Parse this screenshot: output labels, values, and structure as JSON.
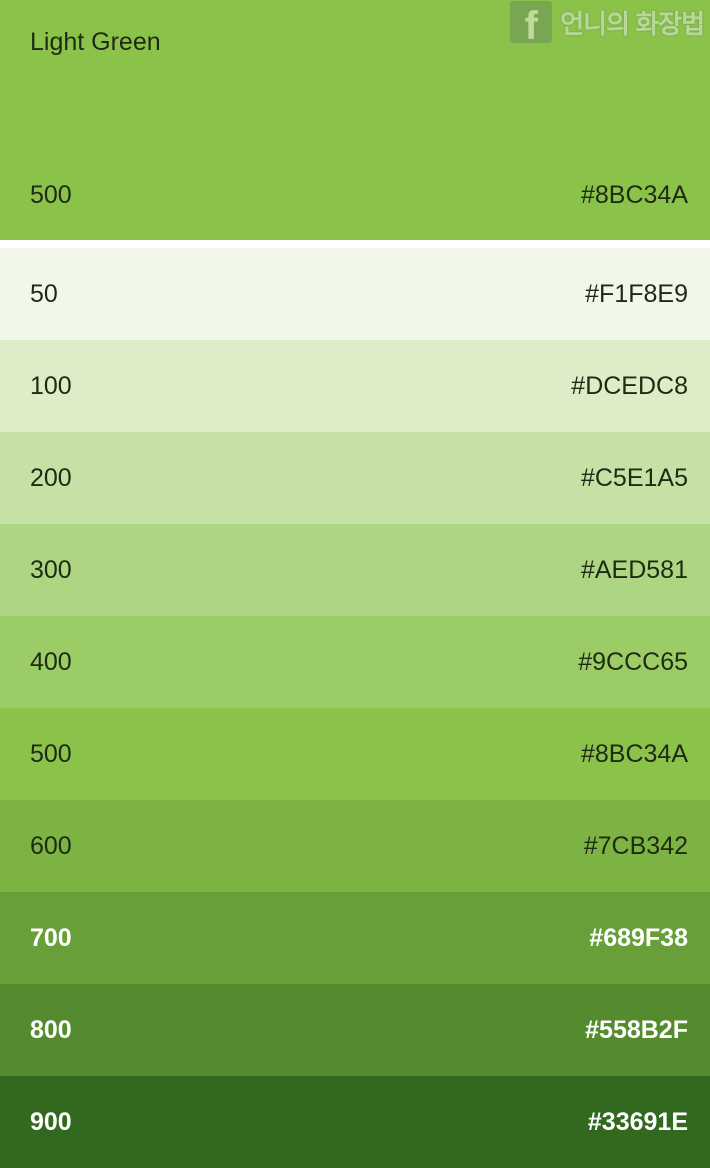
{
  "header": {
    "name": "Light Green",
    "shade": "500",
    "hex": "#8BC34A",
    "color": "#8BC34A"
  },
  "watermark": {
    "icon": "facebook-icon",
    "icon_glyph": "f",
    "text": "언니의 화장법"
  },
  "swatches": [
    {
      "shade": "50",
      "hex": "#F1F8E9",
      "color": "#F1F8E9",
      "text": "dark"
    },
    {
      "shade": "100",
      "hex": "#DCEDC8",
      "color": "#DCEDC8",
      "text": "dark"
    },
    {
      "shade": "200",
      "hex": "#C5E1A5",
      "color": "#C5E1A5",
      "text": "dark"
    },
    {
      "shade": "300",
      "hex": "#AED581",
      "color": "#AED581",
      "text": "dark"
    },
    {
      "shade": "400",
      "hex": "#9CCC65",
      "color": "#9CCC65",
      "text": "dark"
    },
    {
      "shade": "500",
      "hex": "#8BC34A",
      "color": "#8BC34A",
      "text": "dark"
    },
    {
      "shade": "600",
      "hex": "#7CB342",
      "color": "#7CB342",
      "text": "dark"
    },
    {
      "shade": "700",
      "hex": "#689F38",
      "color": "#689F38",
      "text": "light"
    },
    {
      "shade": "800",
      "hex": "#558B2F",
      "color": "#558B2F",
      "text": "light"
    },
    {
      "shade": "900",
      "hex": "#33691E",
      "color": "#33691E",
      "text": "light"
    }
  ]
}
